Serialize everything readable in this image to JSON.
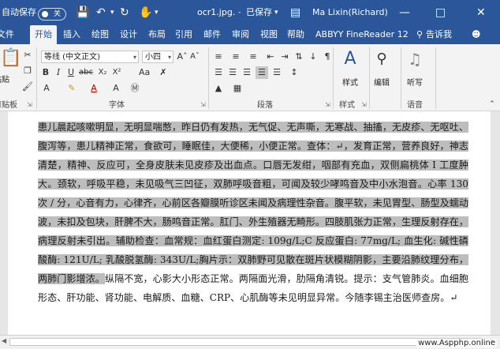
{
  "titlebar": {
    "autosave_label": "自动保存",
    "autosave_state": "关",
    "filename": "ocr1.jpg.",
    "save_status": "已保存",
    "user": "Ma Lixin(Richard)"
  },
  "tabs": [
    "文件",
    "开始",
    "插入",
    "绘图",
    "设计",
    "布局",
    "引用",
    "邮件",
    "审阅",
    "视图",
    "帮助",
    "ABBYY FineReader 12",
    "告诉我"
  ],
  "active_tab": "开始",
  "ribbon": {
    "clipboard_label": "剪贴板",
    "paste_label": "粘贴",
    "font_name": "等线 (中文正文)",
    "font_size": "小四",
    "font_group_label": "字体",
    "paragraph_group_label": "段落",
    "styles_label": "样式",
    "styles_group_label": "样式",
    "editing_label": "编辑",
    "dictate_label": "听写",
    "voice_group_label": "语音"
  },
  "document": {
    "selected_text": "患儿晨起咳嗽明显，无明显喘憋，昨日仍有发热，无气促、无声嘶，无寒战、抽搐，无皮疹、无呕吐、腹泻等，患儿精神正常，食欲可，睡眠佳，大便稀，小便正常。查体：↵，发育正常，营养良好，神志清楚，精神、反应可，全身皮肤未见皮疹及出血点。口唇无发绀，咽部有充血，双侧扁桃体 I 工度肿大。颈软，呼吸平稳，未见吸气三凹征，双肺呼吸音粗，可闻及较少哮鸣音及中小水泡音。心率 130 次 / 分，心音有力，心律齐，心前区各瓣膜听诊区未闻及病理性杂音。腹平软，未见胃型、肠型及蠕动波，未扣及包块，肝脾不大，肠鸣音正常。肛门、外生殖器无畸形。四肢肌张力正常，生理反射存在，病理反射未引出。辅助检查：血常规：血红蛋白测定: 109g/L;C 反应蛋白: 77mg/L; 血生化: 碱性磷酸酶: 121U/L; 乳酸脱氢酶: 343U/L;胸片示：双肺野可见散在斑片状模糊阴影，主要沿肺纹理分布，两肺门影增浓。",
    "unselected_text": "纵隔不宽，心影大小形态正常。两隔面光滑，肋隔角清锐。提示：支气管肺炎。血细胞形态、肝功能、肾功能、电解质、血糖、CRP、心肌酶等未见明显异常。今随李锡主治医师查房。↵"
  },
  "watermark": "www.Aspphp.online",
  "colors": {
    "title_blue": "#2b579a",
    "ribbon_bg": "#f3f3f3",
    "selection": "#bdbdbd"
  }
}
